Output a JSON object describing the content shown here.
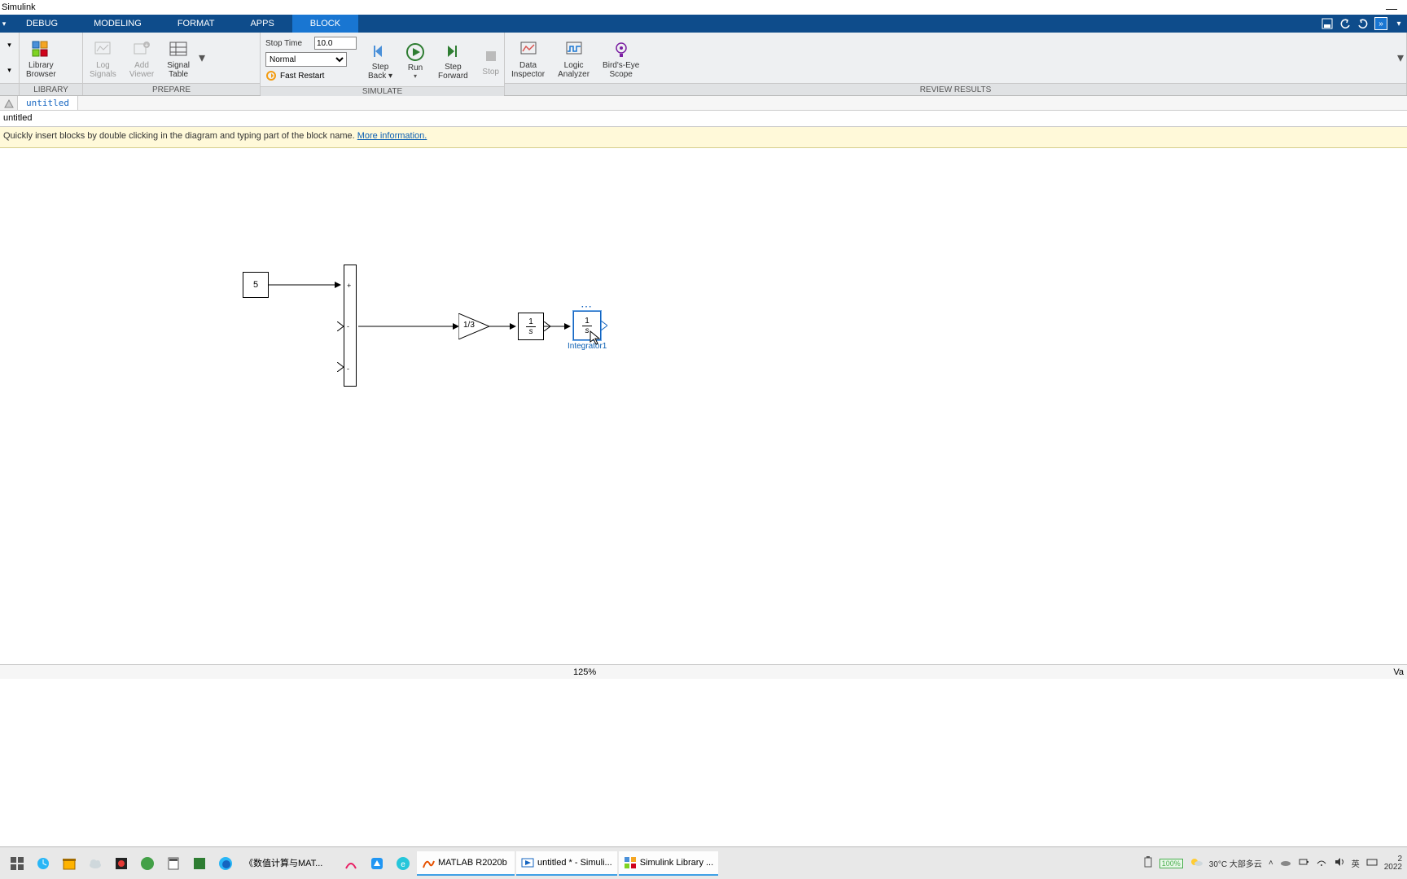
{
  "window": {
    "title": "Simulink"
  },
  "tabs": {
    "debug": "DEBUG",
    "modeling": "MODELING",
    "format": "FORMAT",
    "apps": "APPS",
    "block": "BLOCK"
  },
  "ribbon": {
    "library_btn": "Library\nBrowser",
    "library_group": "LIBRARY",
    "log_signals": "Log\nSignals",
    "add_viewer": "Add\nViewer",
    "signal_table": "Signal\nTable",
    "prepare_group": "PREPARE",
    "stop_time_label": "Stop Time",
    "stop_time_value": "10.0",
    "sim_mode": "Normal",
    "fast_restart": "Fast Restart",
    "step_back": "Step\nBack ▾",
    "run": "Run",
    "step_forward": "Step\nForward",
    "stop": "Stop",
    "simulate_group": "SIMULATE",
    "data_inspector": "Data\nInspector",
    "logic_analyzer": "Logic\nAnalyzer",
    "birds_eye": "Bird's-Eye\nScope",
    "review_group": "REVIEW RESULTS"
  },
  "breadcrumb": {
    "tab": "untitled"
  },
  "pathbar": {
    "text": "untitled"
  },
  "banner": {
    "text": "Quickly insert blocks by double clicking in the diagram and typing part of the block name. ",
    "link": "More information."
  },
  "diagram": {
    "constant_value": "5",
    "gain_value": "1/3",
    "integrator_frac_num": "1",
    "integrator_frac_den": "s",
    "integrator1_frac_num": "1",
    "integrator1_frac_den": "s",
    "integrator1_label": "Integrator1",
    "sum_ports": {
      "p1": "+",
      "p2": "-",
      "p3": "-"
    }
  },
  "statusbar": {
    "zoom": "125%",
    "right_text": "Va"
  },
  "taskbar": {
    "apps": {
      "doc": "《数值计算与MAT...",
      "matlab": "MATLAB R2020b",
      "simulink": "untitled * - Simuli...",
      "lib": "Simulink Library ..."
    },
    "battery": "100%",
    "weather": "30°C  大部多云",
    "ime": "英",
    "year": "2022",
    "day": "2"
  }
}
